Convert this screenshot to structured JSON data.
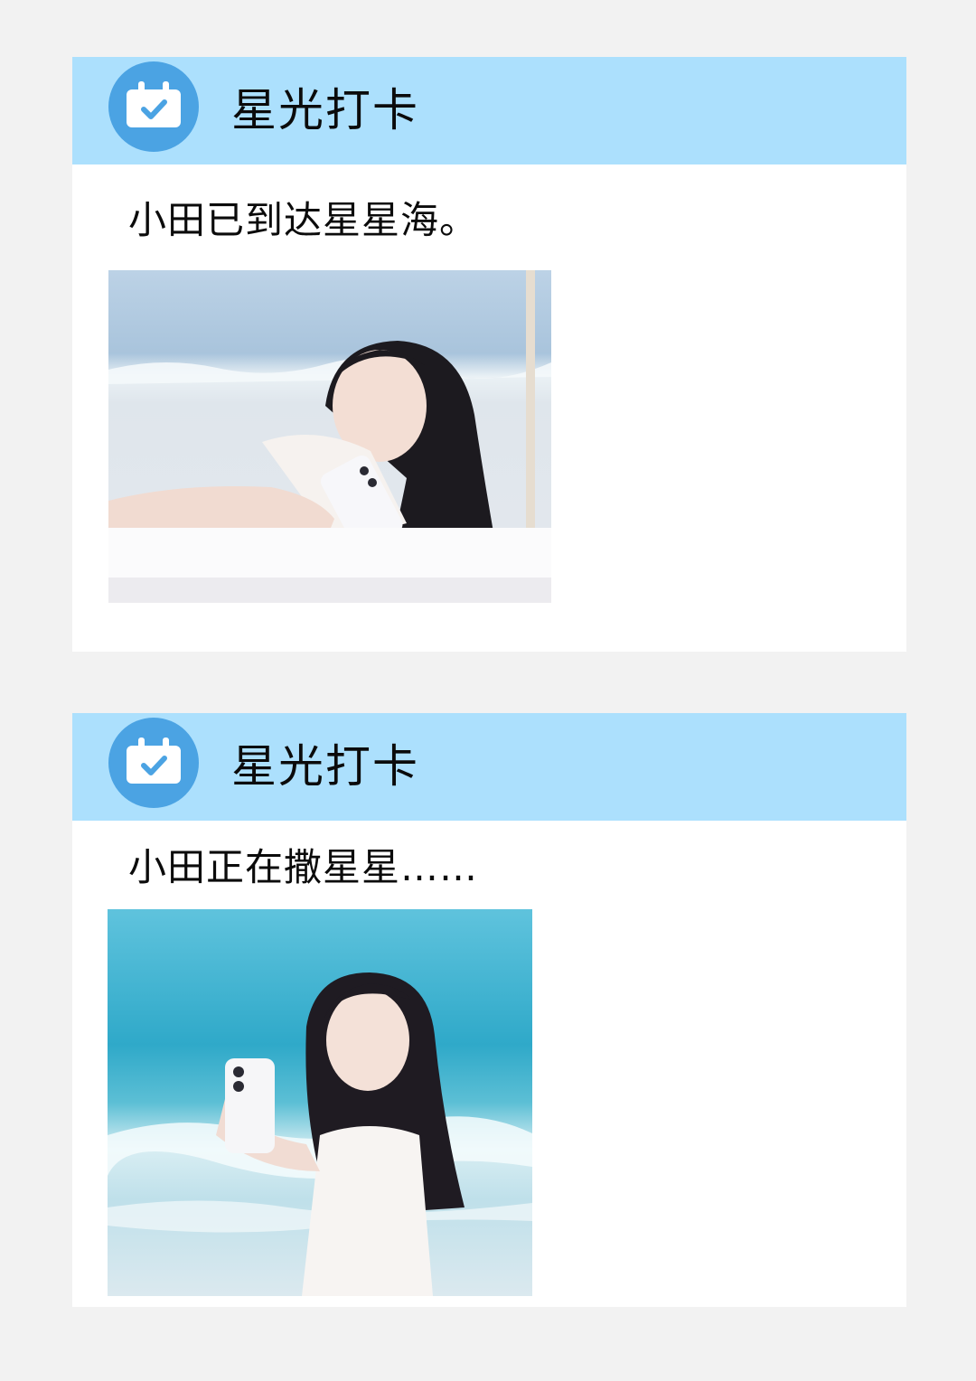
{
  "posts": [
    {
      "header_title": "星光打卡",
      "header_icon": "calendar-check-icon",
      "text": "小田已到达星星海。",
      "photo_alt": "photo of a woman on a beach swing holding a white phone"
    },
    {
      "header_title": "星光打卡",
      "header_icon": "calendar-check-icon",
      "text": "小田正在撒星星……",
      "photo_alt": "photo of a woman standing in the sea holding up a white phone"
    }
  ],
  "colors": {
    "page_background": "#f2f2f2",
    "card_background": "#ffffff",
    "header_background": "#ace0fd",
    "icon_circle": "#4ba3e3",
    "text": "#0b0b0b"
  }
}
